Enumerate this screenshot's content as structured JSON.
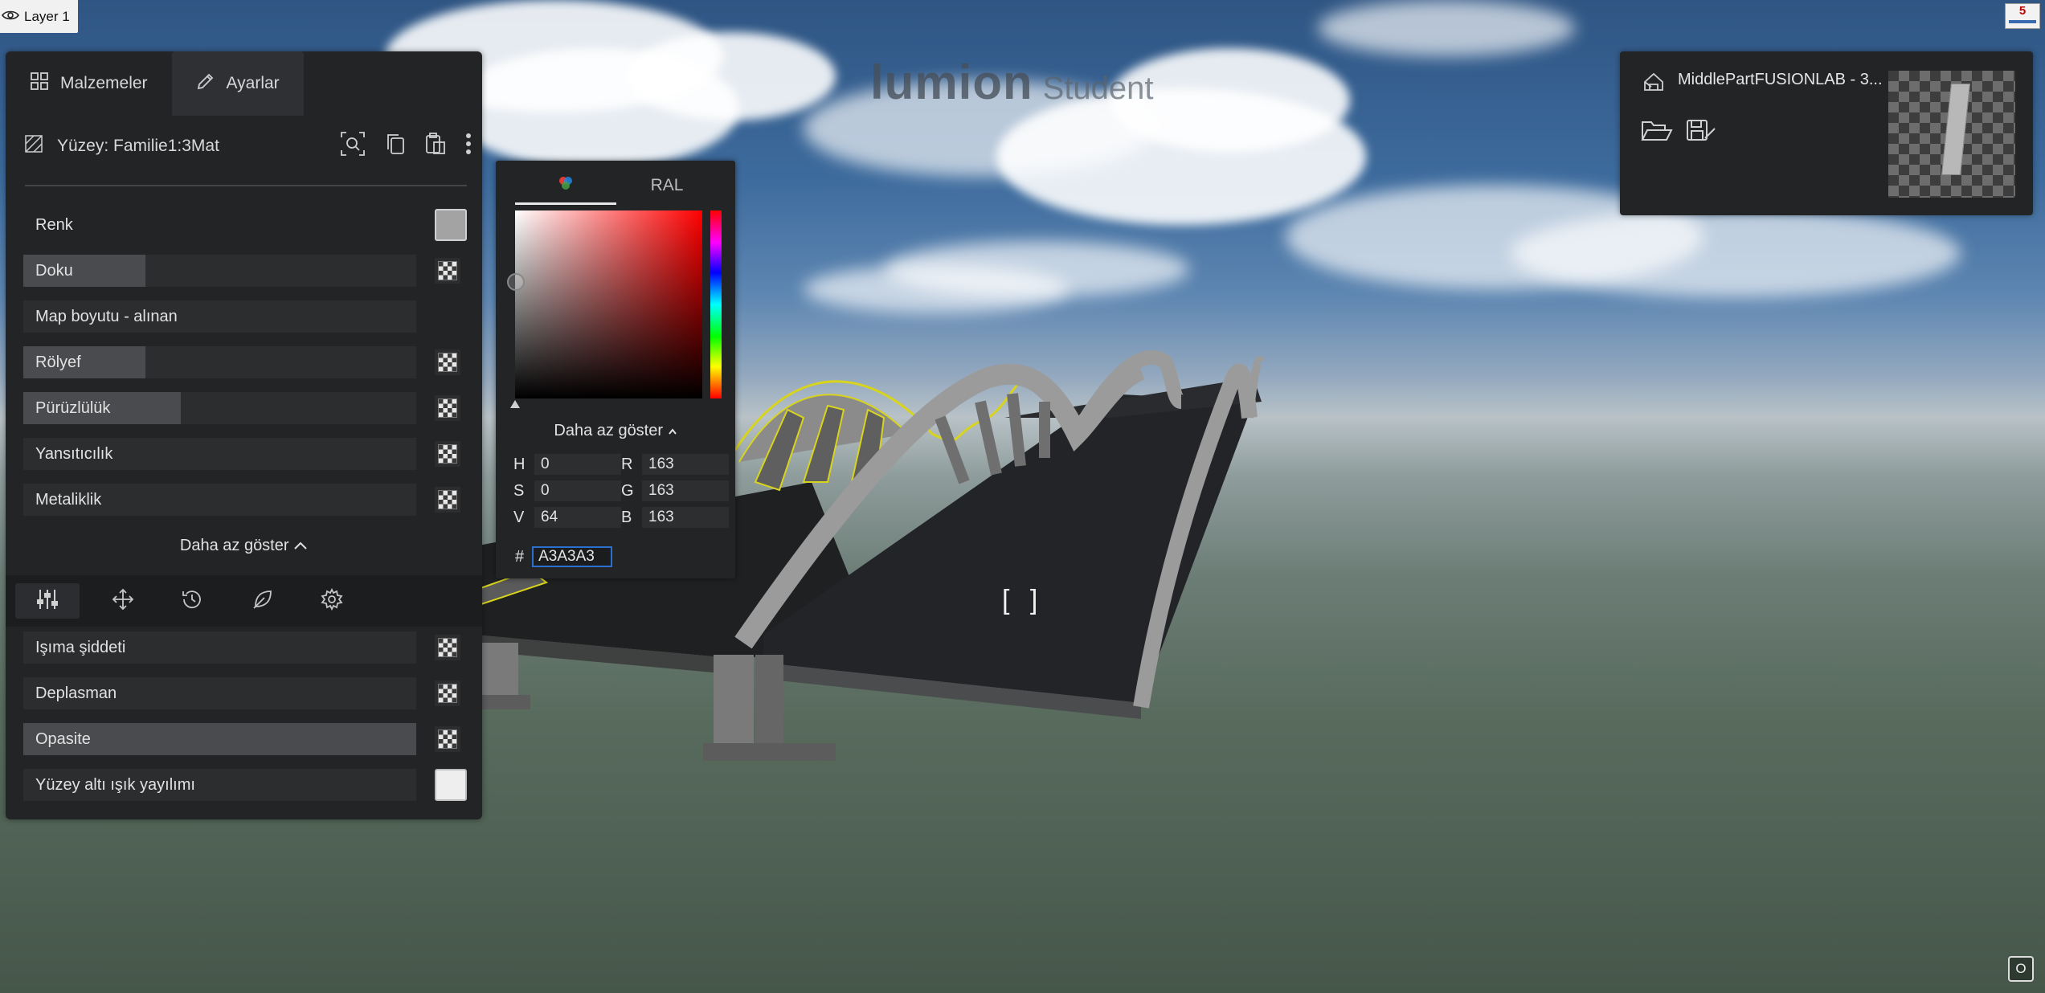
{
  "layer": {
    "label": "Layer 1"
  },
  "top_right_badge": {
    "label": "5"
  },
  "logo": {
    "main": "lumion",
    "sub": "Student"
  },
  "tabs": [
    {
      "label": "Malzemeler",
      "icon": "grid-icon"
    },
    {
      "label": "Ayarlar",
      "icon": "pencil-icon"
    }
  ],
  "surface": {
    "label": "Yüzey: Familie1:3Mat"
  },
  "properties": [
    {
      "label": "Renk",
      "fill": 0,
      "control": "color"
    },
    {
      "label": "Doku",
      "fill": 0.31,
      "control": "map"
    },
    {
      "label": "Map boyutu - alınan",
      "fill": 0,
      "control": "none"
    },
    {
      "label": "Rölyef",
      "fill": 0.31,
      "control": "map"
    },
    {
      "label": "Pürüzlülük",
      "fill": 0.4,
      "control": "map"
    },
    {
      "label": "Yansıtıcılık",
      "fill": 0,
      "control": "map"
    },
    {
      "label": "Metaliklik",
      "fill": 0,
      "control": "map"
    }
  ],
  "show_less": "Daha az göster",
  "bottom_tabs": [
    "sliders-icon",
    "move-icon",
    "history-icon",
    "leaf-icon",
    "gear-icon"
  ],
  "advanced_properties": [
    {
      "label": "Işıma şiddeti",
      "fill": 0,
      "control": "map"
    },
    {
      "label": "Deplasman",
      "fill": 0,
      "control": "map"
    },
    {
      "label": "Opasite",
      "fill": 1.0,
      "control": "map"
    },
    {
      "label": "Yüzey altı ışık yayılımı",
      "fill": 0,
      "control": "white-swatch"
    }
  ],
  "picker": {
    "tab_ral": "RAL",
    "show_less": "Daha az göster",
    "fields": {
      "H": "0",
      "S": "0",
      "V": "64",
      "R": "163",
      "G": "163",
      "B": "163"
    },
    "hex_label": "#",
    "hex_value": "A3A3A3"
  },
  "model_panel": {
    "title": "MiddlePartFUSIONLAB - 3..."
  },
  "colors": {
    "accent": "#2b6fcf",
    "panel": "#232426",
    "swatch": "#a3a3a3"
  }
}
